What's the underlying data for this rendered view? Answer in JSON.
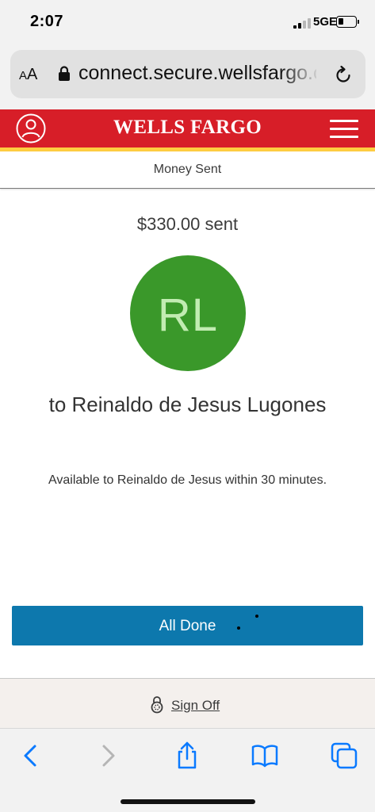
{
  "status_bar": {
    "time": "2:07",
    "network": "5GE",
    "signal_bars_active": 2,
    "signal_bars_total": 4,
    "battery_level": 0.25
  },
  "browser": {
    "text_size_label_small": "A",
    "text_size_label_large": "A",
    "url": "connect.secure.wellsfargo.com"
  },
  "header": {
    "logo_text": "WELLS FARGO",
    "brand_red": "#d71e28",
    "brand_gold": "#ffcd41"
  },
  "page": {
    "title": "Money Sent"
  },
  "confirmation": {
    "amount_text": "$330.00 sent",
    "avatar_initials": "RL",
    "avatar_color": "#3a982a",
    "recipient_text": "to Reinaldo de Jesus Lugones",
    "availability_text": "Available to Reinaldo de Jesus within 30 minutes."
  },
  "actions": {
    "done_label": "All Done",
    "button_color": "#0d78ad"
  },
  "footer": {
    "sign_off_label": "Sign Off"
  },
  "toolbar": {
    "icons": [
      "back-icon",
      "forward-icon",
      "share-icon",
      "bookmarks-icon",
      "tabs-icon"
    ],
    "accent": "#0a7aff"
  }
}
